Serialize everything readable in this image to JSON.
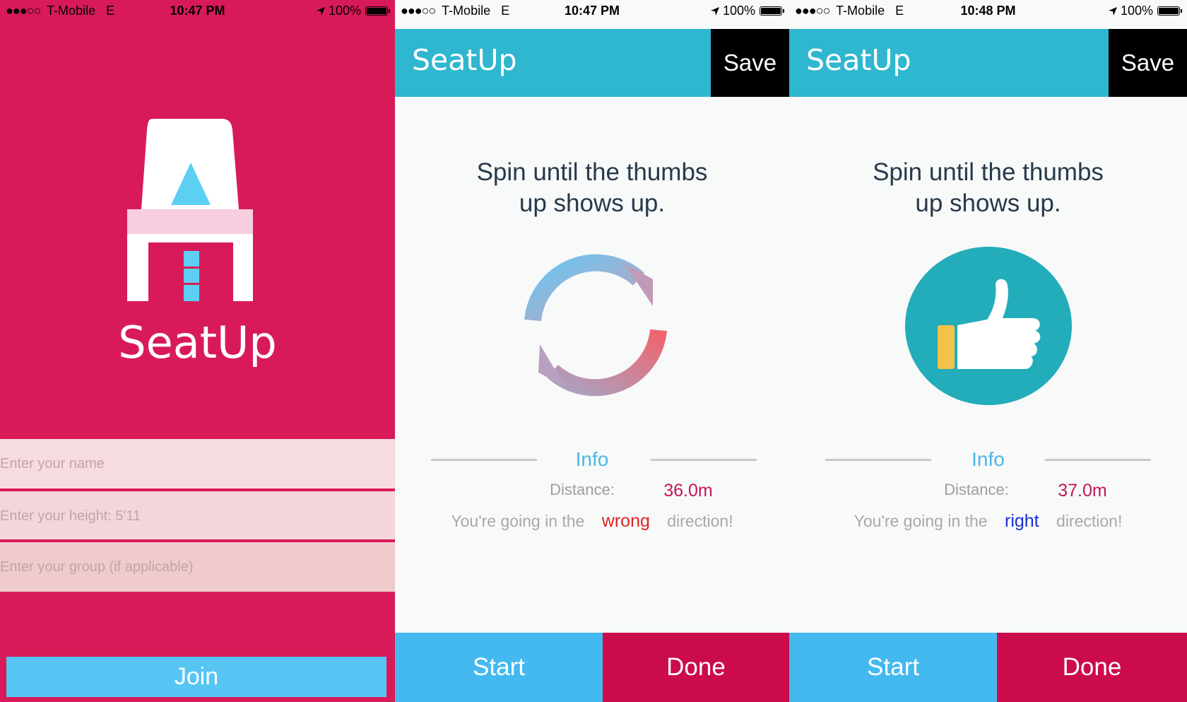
{
  "screen1": {
    "status": {
      "signal": "●●●○○",
      "carrier": "T-Mobile",
      "network": "E",
      "time": "10:47 PM",
      "battery": "100%"
    },
    "brand": "SeatUp",
    "name_placeholder": "Enter your name",
    "height_placeholder": "Enter your height: 5'11",
    "group_placeholder": "Enter your group (if applicable)",
    "join_label": "Join",
    "colors": {
      "background": "#d81b58",
      "join": "#56c5f4"
    }
  },
  "screen2": {
    "status": {
      "signal": "●●●○○",
      "carrier": "T-Mobile",
      "network": "E",
      "time": "10:47 PM",
      "battery": "100%"
    },
    "title": "SeatUp",
    "save_label": "Save",
    "headline_line1": "Spin until the thumbs",
    "headline_line2": "up shows up.",
    "icon": "refresh-icon",
    "info_label": "Info",
    "distance_label": "Distance:",
    "distance_value": "36.0m",
    "direction_prefix": "You're going in the",
    "direction_word": "wrong",
    "direction_suffix": "direction!",
    "start_label": "Start",
    "done_label": "Done"
  },
  "screen3": {
    "status": {
      "signal": "●●●○○",
      "carrier": "T-Mobile",
      "network": "E",
      "time": "10:48 PM",
      "battery": "100%"
    },
    "title": "SeatUp",
    "save_label": "Save",
    "headline_line1": "Spin until the thumbs",
    "headline_line2": "up shows up.",
    "icon": "thumbs-up-icon",
    "info_label": "Info",
    "distance_label": "Distance:",
    "distance_value": "37.0m",
    "direction_prefix": "You're going in the",
    "direction_word": "right",
    "direction_suffix": "direction!",
    "start_label": "Start",
    "done_label": "Done"
  }
}
